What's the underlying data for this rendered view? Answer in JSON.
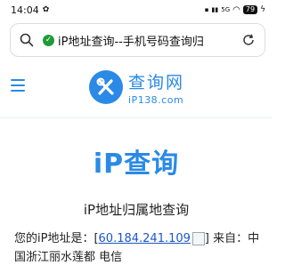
{
  "status_bar": {
    "time": "14:04",
    "network": "5G",
    "battery": "79"
  },
  "browser": {
    "url_display": "iP地址查询--手机号码查询归"
  },
  "site": {
    "logo_cn": "查询网",
    "logo_en": "iP138.com"
  },
  "main": {
    "title": "iP查询",
    "subtitle": "iP地址归属地查询",
    "ip_label": "您的iP地址是：[",
    "ip_value": "60.184.241.109",
    "ip_suffix": "] 来自：中",
    "location": "国浙江丽水莲都 电信"
  },
  "colors": {
    "brand": "#2a8ae6",
    "secure": "#1f9b3a",
    "link": "#1a56c8"
  }
}
